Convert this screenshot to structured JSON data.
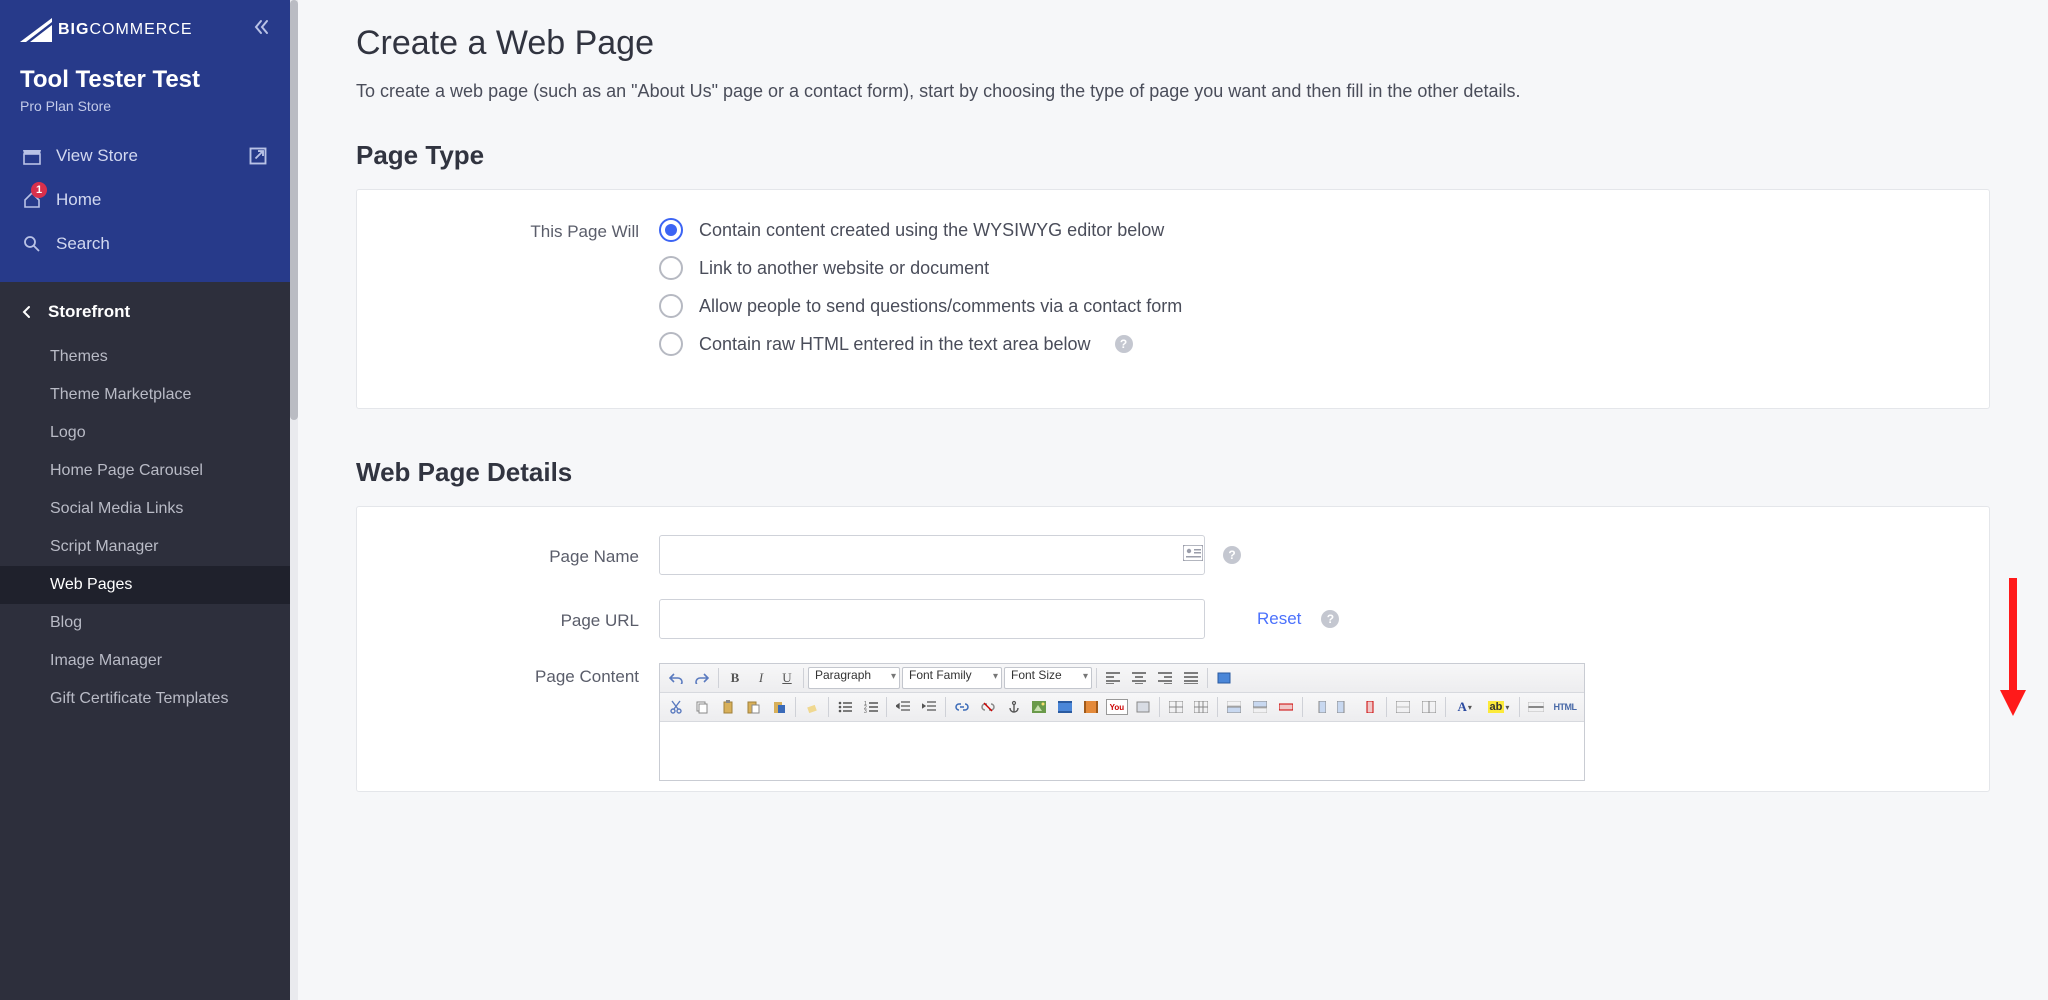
{
  "brand": {
    "big": "BIG",
    "commerce": "COMMERCE"
  },
  "store": {
    "name": "Tool Tester Test",
    "plan": "Pro Plan Store"
  },
  "topnav": {
    "view_store": "View Store",
    "home": "Home",
    "home_badge": "1",
    "search": "Search"
  },
  "section": {
    "title": "Storefront"
  },
  "subnav": {
    "themes": "Themes",
    "marketplace": "Theme Marketplace",
    "logo": "Logo",
    "carousel": "Home Page Carousel",
    "social": "Social Media Links",
    "script": "Script Manager",
    "webpages": "Web Pages",
    "blog": "Blog",
    "image": "Image Manager",
    "gift": "Gift Certificate Templates"
  },
  "page": {
    "title": "Create a Web Page",
    "intro": "To create a web page (such as an \"About Us\" page or a contact form), start by choosing the type of page you want and then fill in the other details."
  },
  "pageType": {
    "heading": "Page Type",
    "label": "This Page Will",
    "opt1": "Contain content created using the WYSIWYG editor below",
    "opt2": "Link to another website or document",
    "opt3": "Allow people to send questions/comments via a contact form",
    "opt4": "Contain raw HTML entered in the text area below"
  },
  "details": {
    "heading": "Web Page Details",
    "name_label": "Page Name",
    "url_label": "Page URL",
    "content_label": "Page Content",
    "reset": "Reset"
  },
  "toolbar": {
    "paragraph": "Paragraph",
    "fontfamily": "Font Family",
    "fontsize": "Font Size",
    "html": "HTML",
    "youtube": "You"
  }
}
